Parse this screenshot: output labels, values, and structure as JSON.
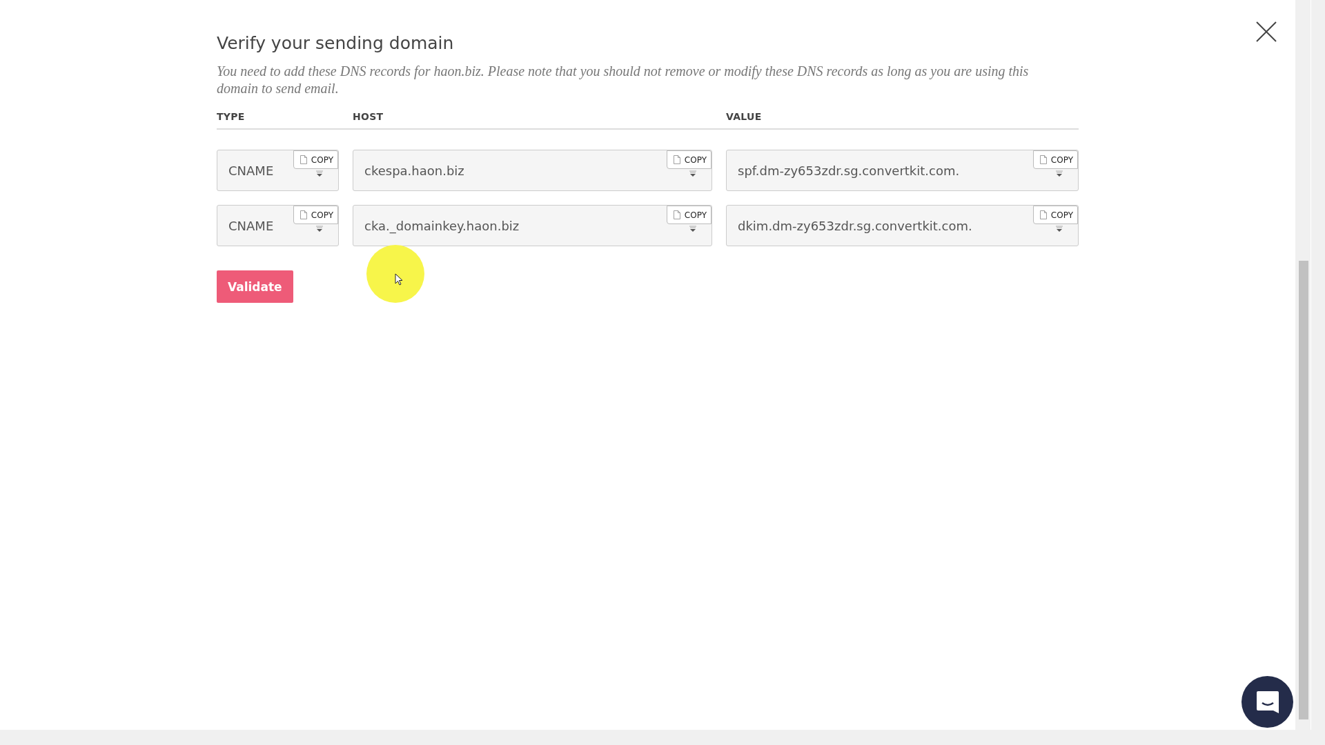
{
  "dialog": {
    "title": "Verify your sending domain",
    "description": "You need to add these DNS records for haon.biz. Please note that you should not remove or modify these DNS records as long as you are using this domain to send email."
  },
  "table": {
    "columns": [
      "TYPE",
      "HOST",
      "VALUE"
    ],
    "rows": [
      {
        "cells": [
          {
            "value": "CNAME",
            "copy_label": "COPY"
          },
          {
            "value": "ckespa.haon.biz",
            "copy_label": "COPY"
          },
          {
            "value": "spf.dm-zy653zdr.sg.convertkit.com.",
            "copy_label": "COPY"
          }
        ]
      },
      {
        "cells": [
          {
            "value": "CNAME",
            "copy_label": "COPY"
          },
          {
            "value": "cka._domainkey.haon.biz",
            "copy_label": "COPY"
          },
          {
            "value": "dkim.dm-zy653zdr.sg.convertkit.com.",
            "copy_label": "COPY"
          }
        ]
      }
    ]
  },
  "validate_button": "Validate"
}
